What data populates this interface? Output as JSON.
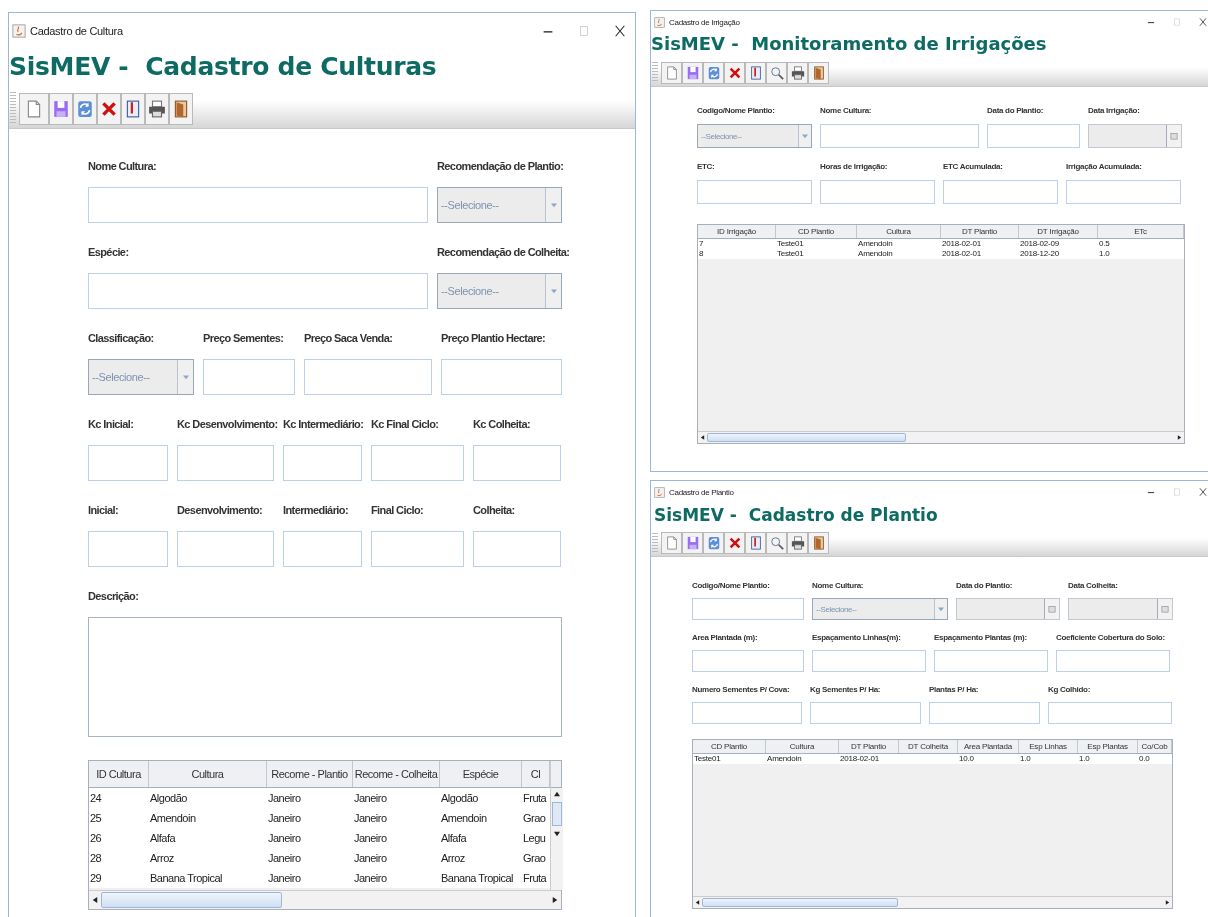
{
  "windows": [
    {
      "title": "Cadastro de Cultura",
      "heading": "SisMEV -  Cadastro de Culturas",
      "toolbar": [
        {
          "kind": "new"
        },
        {
          "kind": "save"
        },
        {
          "kind": "refresh"
        },
        {
          "kind": "delete"
        },
        {
          "kind": "book"
        },
        {
          "kind": "print"
        },
        {
          "kind": "exit"
        }
      ],
      "form": [
        [
          {
            "label": "Nome Cultura:",
            "kind": "text",
            "disabled": false
          },
          {
            "label": "Recomendação de Plantio:",
            "kind": "combo",
            "value": "--Selecione--",
            "disabled": true
          }
        ],
        [
          {
            "label": "Espécie:",
            "kind": "text",
            "disabled": false
          },
          {
            "label": "Recomendação de Colheita:",
            "kind": "combo",
            "value": "--Selecione--",
            "disabled": true
          }
        ],
        [
          {
            "label": "Classificação:",
            "kind": "combo",
            "value": "--Selecione--",
            "disabled": true
          },
          {
            "label": "Preço Sementes:",
            "kind": "text",
            "disabled": false
          },
          {
            "label": "Preço Saca Venda:",
            "kind": "text",
            "disabled": false
          },
          {
            "label": "Preço Plantio Hectare:",
            "kind": "text",
            "disabled": false
          }
        ],
        [
          {
            "label": "Kc Inicial:",
            "kind": "text",
            "disabled": false
          },
          {
            "label": "Kc Desenvolvimento:",
            "kind": "text",
            "disabled": false
          },
          {
            "label": "Kc Intermediário:",
            "kind": "text",
            "disabled": false
          },
          {
            "label": "Kc Final Ciclo:",
            "kind": "text",
            "disabled": false
          },
          {
            "label": "Kc Colheita:",
            "kind": "text",
            "disabled": false
          }
        ],
        [
          {
            "label": "Inicial:",
            "kind": "text",
            "disabled": false
          },
          {
            "label": "Desenvolvimento:",
            "kind": "text",
            "disabled": false
          },
          {
            "label": "Intermediário:",
            "kind": "text",
            "disabled": false
          },
          {
            "label": "Final Ciclo:",
            "kind": "text",
            "disabled": false
          },
          {
            "label": "Colheita:",
            "kind": "text",
            "disabled": false
          }
        ],
        [
          {
            "label": "Descrição:",
            "kind": "textarea",
            "disabled": false
          }
        ]
      ],
      "table": {
        "columns": [
          "ID Cultura",
          "Cultura",
          "Recome - Plantio",
          "Recome - Colheita",
          "Espécie",
          "Cl"
        ],
        "rows": [
          [
            "24",
            "Algodão",
            "Janeiro",
            "Janeiro",
            "Algodão",
            "Fruta"
          ],
          [
            "25",
            "Amendoin",
            "Janeiro",
            "Janeiro",
            "Amendoin",
            "Grao"
          ],
          [
            "26",
            "Alfafa",
            "Janeiro",
            "Janeiro",
            "Alfafa",
            "Legu"
          ],
          [
            "28",
            "Arroz",
            "Janeiro",
            "Janeiro",
            "Arroz",
            "Grao"
          ],
          [
            "29",
            "Banana Tropical",
            "Janeiro",
            "Janeiro",
            "Banana Tropical",
            "Fruta"
          ]
        ]
      }
    },
    {
      "title": "Cadastro de Irrigação",
      "heading": "SisMEV -  Monitoramento de Irrigações",
      "toolbar": [
        {
          "kind": "new"
        },
        {
          "kind": "save"
        },
        {
          "kind": "refresh"
        },
        {
          "kind": "delete"
        },
        {
          "kind": "book"
        },
        {
          "kind": "search"
        },
        {
          "kind": "print"
        },
        {
          "kind": "exit"
        }
      ],
      "form": [
        [
          {
            "label": "Codigo/Nome Plantio:",
            "kind": "combo",
            "value": "--Selecione--",
            "disabled": true
          },
          {
            "label": "Nome Cultura:",
            "kind": "text",
            "disabled": false
          },
          {
            "label": "Data do Plantio:",
            "kind": "text",
            "disabled": false
          },
          {
            "label": "Data Irrigação:",
            "kind": "date",
            "disabled": true
          }
        ],
        [
          {
            "label": "ETC:",
            "kind": "text",
            "disabled": false
          },
          {
            "label": "Horas de Irrigação:",
            "kind": "text",
            "disabled": false
          },
          {
            "label": "ETC Acumulada:",
            "kind": "text",
            "disabled": false
          },
          {
            "label": "Irrigação Acumulada:",
            "kind": "text",
            "disabled": false
          }
        ]
      ],
      "table": {
        "columns": [
          "ID Irrigação",
          "CD Plantio",
          "Cultura",
          "DT Plantio",
          "DT Irrigação",
          "ETc"
        ],
        "rows": [
          [
            "7",
            "Teste01",
            "Amendoin",
            "2018-02-01",
            "2018-02-09",
            "0.5"
          ],
          [
            "8",
            "Teste01",
            "Amendoin",
            "2018-02-01",
            "2018-12-20",
            "1.0"
          ]
        ]
      }
    },
    {
      "title": "Cadastro de Plantio",
      "heading": "SisMEV -  Cadastro de Plantio",
      "toolbar": [
        {
          "kind": "new"
        },
        {
          "kind": "save"
        },
        {
          "kind": "refresh"
        },
        {
          "kind": "delete"
        },
        {
          "kind": "book"
        },
        {
          "kind": "search"
        },
        {
          "kind": "print"
        },
        {
          "kind": "exit"
        }
      ],
      "form": [
        [
          {
            "label": "Codigo/Nome Plantio:",
            "kind": "text",
            "disabled": false
          },
          {
            "label": "Nome Cultura:",
            "kind": "combo",
            "value": "--Selecione--",
            "disabled": true
          },
          {
            "label": "Data do Plantio:",
            "kind": "date",
            "disabled": true
          },
          {
            "label": "Data  Colheita:",
            "kind": "date",
            "disabled": true
          }
        ],
        [
          {
            "label": "Area Plantada (m):",
            "kind": "text",
            "disabled": false
          },
          {
            "label": "Espaçamento Linhas(m):",
            "kind": "text",
            "disabled": false
          },
          {
            "label": "Espaçamento Plantas (m):",
            "kind": "text",
            "disabled": false
          },
          {
            "label": "Coeficiente Cobertura do Solo:",
            "kind": "text",
            "disabled": false
          }
        ],
        [
          {
            "label": "Numero Sementes P/ Cova:",
            "kind": "text",
            "disabled": false
          },
          {
            "label": "Kg Sementes P/ Ha:",
            "kind": "text",
            "disabled": false
          },
          {
            "label": "Plantas P/ Ha:",
            "kind": "text",
            "disabled": false
          },
          {
            "label": "Kg Colhido:",
            "kind": "text",
            "disabled": false
          }
        ]
      ],
      "table": {
        "columns": [
          "CD Plantio",
          "Cultura",
          "DT Plantio",
          "DT Colheita",
          "Area Plantada",
          "Esp Linhas",
          "Esp Plantas",
          "Co/Cob"
        ],
        "rows": [
          [
            "Teste01",
            "Amendoin",
            "2018-02-01",
            null,
            "10.0",
            "1.0",
            "1.0",
            "0.0"
          ]
        ]
      }
    }
  ]
}
